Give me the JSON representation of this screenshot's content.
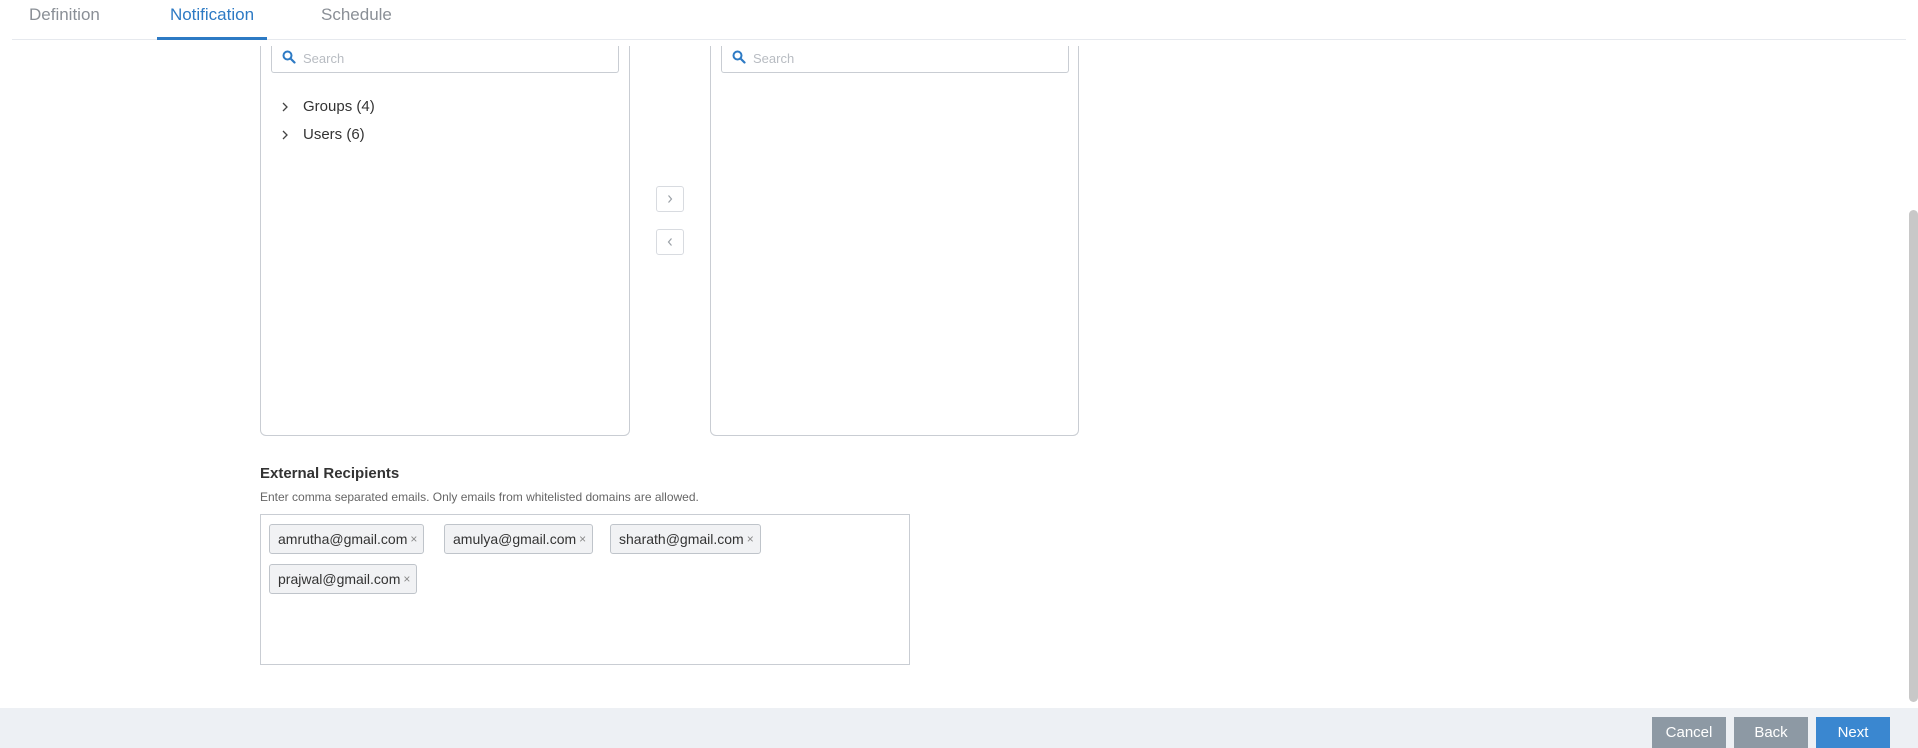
{
  "tabs": [
    {
      "label": "Definition",
      "active": false
    },
    {
      "label": "Notification",
      "active": true
    },
    {
      "label": "Schedule",
      "active": false
    }
  ],
  "available_list": {
    "search_placeholder": "Search",
    "items": [
      {
        "label": "Groups (4)",
        "icon": "chevron-right-icon"
      },
      {
        "label": "Users (6)",
        "icon": "chevron-right-icon"
      }
    ]
  },
  "selected_list": {
    "search_placeholder": "Search",
    "items": []
  },
  "move_buttons": {
    "add_icon": "chevron-right-icon",
    "remove_icon": "chevron-left-icon"
  },
  "external_recipients": {
    "title": "External Recipients",
    "help_text": "Enter comma separated emails. Only emails from whitelisted domains are allowed.",
    "emails": [
      "amrutha@gmail.com",
      "amulya@gmail.com",
      "sharath@gmail.com",
      "prajwal@gmail.com"
    ],
    "remove_glyph": "×"
  },
  "footer": {
    "cancel_label": "Cancel",
    "back_label": "Back",
    "next_label": "Next"
  },
  "colors": {
    "accent": "#2d7ac4",
    "primary_button": "#3a87d0",
    "secondary_button": "#8d99a4",
    "footer_bg": "#edf0f4"
  }
}
